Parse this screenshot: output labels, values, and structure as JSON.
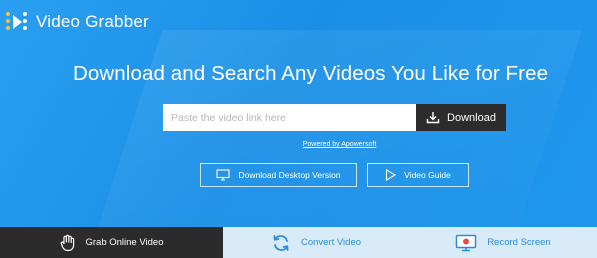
{
  "brand": {
    "name_prefix": "Video ",
    "name_bold": "Grabber",
    "logo_icon": "video-grabber-logo-icon"
  },
  "hero": {
    "headline": "Download and Search Any Videos You Like for Free",
    "search_placeholder": "Paste the video link here",
    "download_label": "Download",
    "powered_by": "Powered by Apowersoft",
    "desktop_label": "Download Desktop Version",
    "guide_label": "Video Guide"
  },
  "tabs": [
    {
      "label": "Grab Online Video",
      "icon": "hand-grab-icon",
      "active": true
    },
    {
      "label": "Convert Video",
      "icon": "refresh-convert-icon",
      "active": false
    },
    {
      "label": "Record Screen",
      "icon": "record-screen-icon",
      "active": false
    }
  ],
  "colors": {
    "hero_blue": "#1f97ec",
    "dark": "#2b2b2b",
    "tab_light": "#d9eaf8",
    "accent": "#2a8ee0",
    "record_red": "#e84a4a"
  }
}
